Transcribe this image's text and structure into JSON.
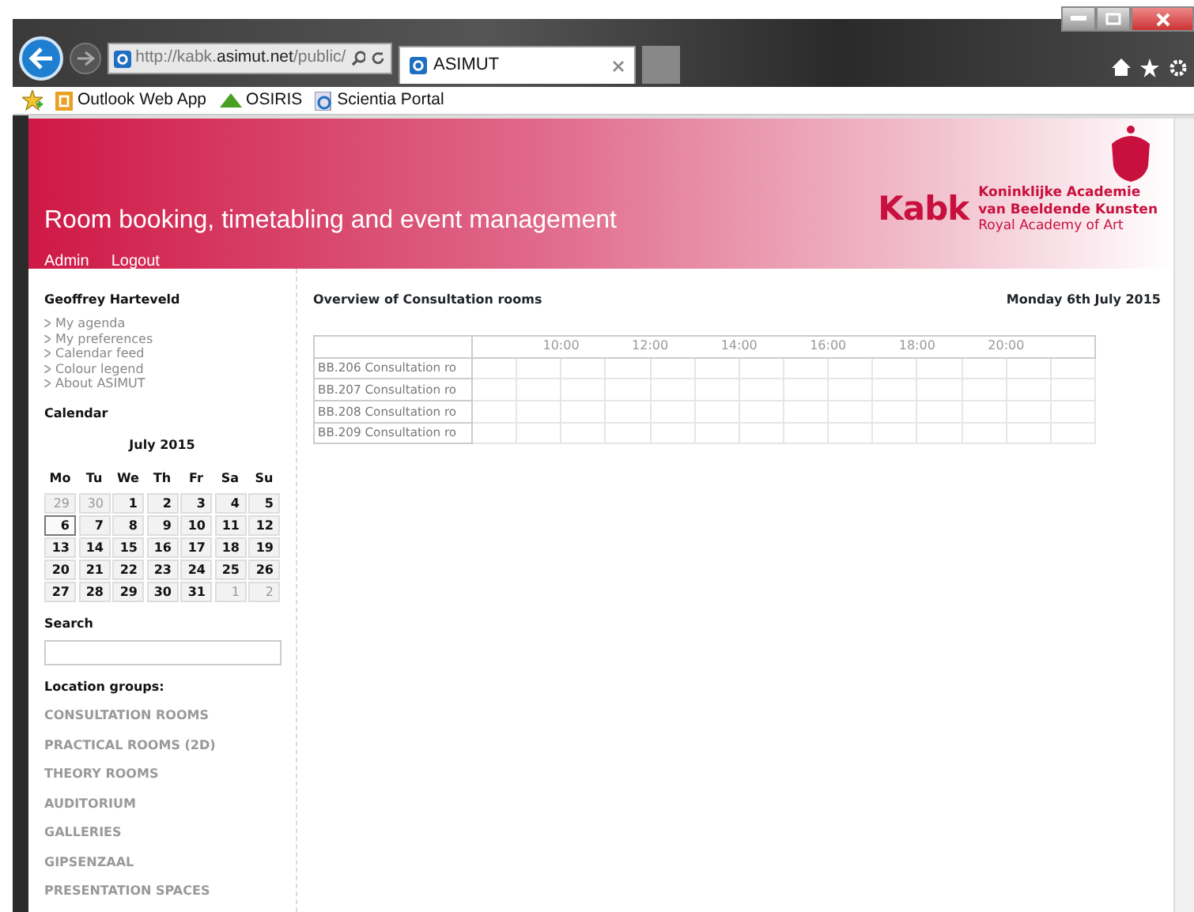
{
  "browser": {
    "address": "http://kabk.**asimut.net**/public/",
    "tab": {
      "title": "ASIMUT",
      "selected": true
    },
    "favorites": [
      "Outlook Web App",
      "OSIRIS",
      "Scientia Portal"
    ]
  },
  "header": {
    "title": "Room booking, timetabling and event management",
    "links": [
      "Admin",
      "Logout"
    ],
    "logo": {
      "mark": "Kabk",
      "lines": [
        "Koninklijke Academie",
        "van Beeldende Kunsten",
        "Royal Academy of Art"
      ]
    }
  },
  "sidebar": {
    "user": "Geoffrey Harteveld",
    "user_links": [
      "My agenda",
      "My preferences",
      "Calendar feed",
      "Colour legend",
      "About ASIMUT"
    ],
    "calendar": {
      "heading": "Calendar",
      "month": "July 2015",
      "weekdays": [
        "Mo",
        "Tu",
        "We",
        "Th",
        "Fr",
        "Sa",
        "Su"
      ],
      "days": [
        {
          "label": "29",
          "outside": true,
          "selected": false
        },
        {
          "label": "30",
          "outside": true,
          "selected": false
        },
        {
          "label": "1",
          "outside": false,
          "selected": false
        },
        {
          "label": "2",
          "outside": false,
          "selected": false
        },
        {
          "label": "3",
          "outside": false,
          "selected": false
        },
        {
          "label": "4",
          "outside": false,
          "selected": false
        },
        {
          "label": "5",
          "outside": false,
          "selected": false
        },
        {
          "label": "6",
          "outside": false,
          "selected": true
        },
        {
          "label": "7",
          "outside": false,
          "selected": false
        },
        {
          "label": "8",
          "outside": false,
          "selected": false
        },
        {
          "label": "9",
          "outside": false,
          "selected": false
        },
        {
          "label": "10",
          "outside": false,
          "selected": false
        },
        {
          "label": "11",
          "outside": false,
          "selected": false
        },
        {
          "label": "12",
          "outside": false,
          "selected": false
        },
        {
          "label": "13",
          "outside": false,
          "selected": false
        },
        {
          "label": "14",
          "outside": false,
          "selected": false
        },
        {
          "label": "15",
          "outside": false,
          "selected": false
        },
        {
          "label": "16",
          "outside": false,
          "selected": false
        },
        {
          "label": "17",
          "outside": false,
          "selected": false
        },
        {
          "label": "18",
          "outside": false,
          "selected": false
        },
        {
          "label": "19",
          "outside": false,
          "selected": false
        },
        {
          "label": "20",
          "outside": false,
          "selected": false
        },
        {
          "label": "21",
          "outside": false,
          "selected": false
        },
        {
          "label": "22",
          "outside": false,
          "selected": false
        },
        {
          "label": "23",
          "outside": false,
          "selected": false
        },
        {
          "label": "24",
          "outside": false,
          "selected": false
        },
        {
          "label": "25",
          "outside": false,
          "selected": false
        },
        {
          "label": "26",
          "outside": false,
          "selected": false
        },
        {
          "label": "27",
          "outside": false,
          "selected": false
        },
        {
          "label": "28",
          "outside": false,
          "selected": false
        },
        {
          "label": "29",
          "outside": false,
          "selected": false
        },
        {
          "label": "30",
          "outside": false,
          "selected": false
        },
        {
          "label": "31",
          "outside": false,
          "selected": false
        },
        {
          "label": "1",
          "outside": true,
          "selected": false
        },
        {
          "label": "2",
          "outside": true,
          "selected": false
        }
      ]
    },
    "search": {
      "label": "Search"
    },
    "location_groups": {
      "heading": "Location groups:",
      "items": [
        "CONSULTATION ROOMS",
        "PRACTICAL ROOMS (2D)",
        "THEORY ROOMS",
        "AUDITORIUM",
        "GALLERIES",
        "GIPSENZAAL",
        "PRESENTATION SPACES"
      ]
    }
  },
  "main": {
    "title": "Overview of Consultation rooms",
    "date": "Monday 6th July 2015",
    "time_labels": [
      "10:00",
      "12:00",
      "14:00",
      "16:00",
      "18:00",
      "20:00"
    ],
    "rooms": [
      "BB.206 Consultation ro",
      "BB.207 Consultation ro",
      "BB.208 Consultation ro",
      "BB.209 Consultation ro"
    ]
  }
}
